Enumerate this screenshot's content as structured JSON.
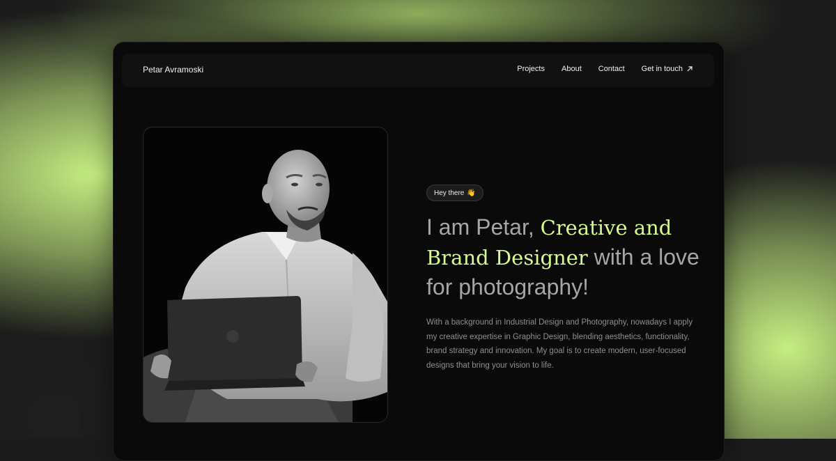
{
  "header": {
    "brand": "Petar Avramoski",
    "nav": [
      {
        "label": "Projects"
      },
      {
        "label": "About"
      },
      {
        "label": "Contact"
      },
      {
        "label": "Get in touch",
        "icon": "arrow-up-right-icon"
      }
    ]
  },
  "hero": {
    "badge": "Hey there",
    "badge_emoji": "👋",
    "headline_prefix": "I am Petar, ",
    "headline_accent": "Creative and Brand Designer",
    "headline_suffix": " with a love for photography!",
    "bio": "With a background in Industrial Design and Photography, nowadays I apply my creative expertise in Graphic Design, blending aesthetics, functionality, brand strategy and innovation. My goal is to create modern, user-focused designs that bring your vision to life.",
    "photo": "portrait-photo"
  },
  "colors": {
    "accent": "#d6fb8f",
    "glow": "#cffa87",
    "background": "#0a0a0a",
    "muted_text": "#a6a6a6"
  }
}
